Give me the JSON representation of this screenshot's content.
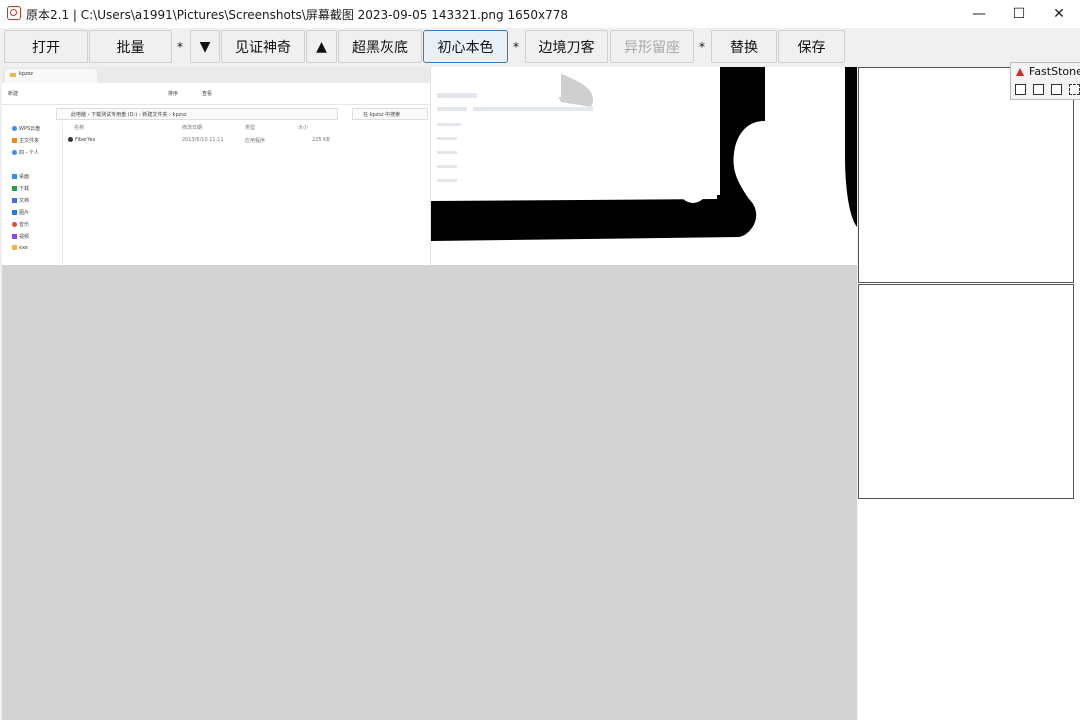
{
  "window": {
    "title": "原本2.1 | C:\\Users\\a1991\\Pictures\\Screenshots\\屏幕截图 2023-09-05 143321.png 1650x778",
    "minimize": "—",
    "maximize": "☐",
    "close": "✕"
  },
  "toolbar": {
    "open": "打开",
    "batch": "批量",
    "sep1": "*",
    "down": "▼",
    "jianzheng": "见证神奇",
    "up": "▲",
    "chaohei": "超黑灰底",
    "chuxin": "初心本色",
    "sep2": "*",
    "bianjing": "边境刀客",
    "yixing": "异形留座",
    "sep3": "*",
    "replace": "替换",
    "save": "保存"
  },
  "faststone": {
    "title": "FastStone C"
  },
  "preview": {
    "tab_label": "kpzsz",
    "new_label": "新建",
    "sort_label": "排序",
    "view_label": "查看",
    "address": "此电脑 › 下载测试专用盘 (D:) › 新建文件夹 › kpzsz",
    "search": "在 kpzsz 中搜索",
    "columns": [
      "名称",
      "修改日期",
      "类型",
      "大小"
    ],
    "row": [
      "FiberYes",
      "2013/6/10 11:11",
      "应用程序",
      "225 KB"
    ],
    "sidebar": [
      "WPS云盘",
      "主文件夹",
      "四 - 个人",
      "桌面",
      "下载",
      "文档",
      "图片",
      "音乐",
      "视频",
      "exe"
    ]
  },
  "colors": {
    "accent": "#2f7ec7",
    "disabled": "#a8a8a8",
    "canvas": "#d3d3d3"
  }
}
